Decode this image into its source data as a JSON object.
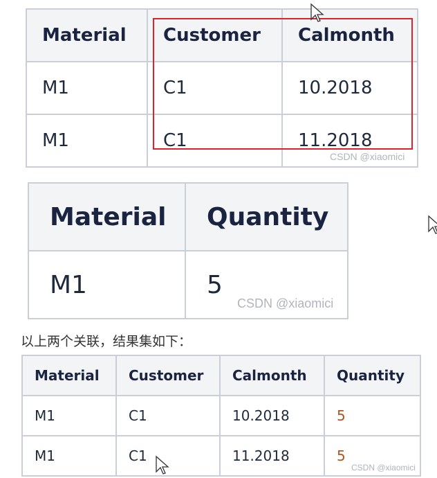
{
  "table1": {
    "headers": [
      "Material",
      "Customer",
      "Calmonth"
    ],
    "rows": [
      [
        "M1",
        "C1",
        "10.2018"
      ],
      [
        "M1",
        "C1",
        "11.2018"
      ]
    ],
    "watermark": "CSDN @xiaomici"
  },
  "table2": {
    "headers": [
      "Material",
      "Quantity"
    ],
    "rows": [
      [
        "M1",
        "5"
      ]
    ],
    "watermark": "CSDN @xiaomici"
  },
  "caption": "以上两个关联，结果集如下：",
  "table3": {
    "headers": [
      "Material",
      "Customer",
      "Calmonth",
      "Quantity"
    ],
    "rows": [
      [
        "M1",
        "C1",
        "10.2018",
        "5"
      ],
      [
        "M1",
        "C1",
        "11.2018",
        "5"
      ]
    ],
    "watermark": "CSDN @xiaomici"
  },
  "colors": {
    "highlight_box": "#e0202a",
    "quantity_value": "#b5531c"
  }
}
